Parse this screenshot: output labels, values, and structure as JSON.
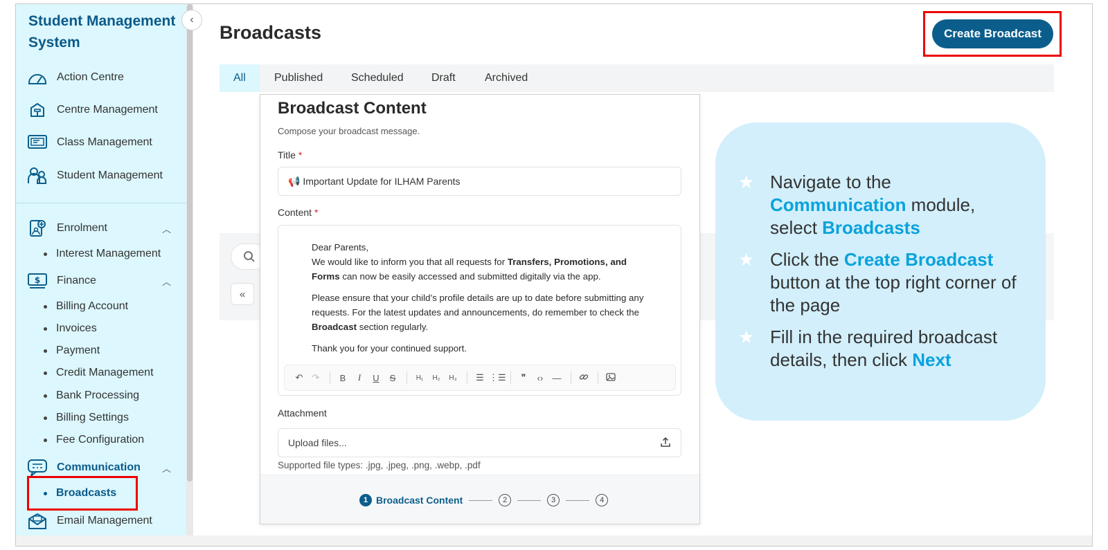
{
  "sidebar": {
    "app_title": "Student Management System",
    "items": {
      "action_centre": "Action Centre",
      "centre_management": "Centre Management",
      "class_management": "Class Management",
      "student_management": "Student Management",
      "enrolment": "Enrolment",
      "interest_management": "Interest Management",
      "finance": "Finance",
      "billing_account": "Billing Account",
      "invoices": "Invoices",
      "payment": "Payment",
      "credit_management": "Credit Management",
      "bank_processing": "Bank Processing",
      "billing_settings": "Billing Settings",
      "fee_configuration": "Fee Configuration",
      "communication": "Communication",
      "broadcasts": "Broadcasts",
      "email_management": "Email Management"
    }
  },
  "header": {
    "title": "Broadcasts",
    "create_button": "Create Broadcast"
  },
  "tabs": [
    "All",
    "Published",
    "Scheduled",
    "Draft",
    "Archived"
  ],
  "card": {
    "title": "Broadcast Content",
    "subtitle": "Compose your broadcast message.",
    "title_label": "Title",
    "title_value": "📢 Important Update for ILHAM Parents",
    "content_label": "Content",
    "content": {
      "greeting": "Dear Parents,",
      "p1_pre": "We would like to inform you that all requests for ",
      "p1_bold": "Transfers, Promotions, and Forms",
      "p1_post": " can now be easily accessed and submitted digitally via the app.",
      "p2_pre": "Please ensure that your child’s profile details are up to date before submitting any requests. For the latest updates and announcements, do remember to check the ",
      "p2_bold": "Broadcast",
      "p2_post": " section regularly.",
      "p3": "Thank you for your continued support."
    },
    "attachment_label": "Attachment",
    "upload_placeholder": "Upload files...",
    "supported_types": "Supported file types: .jpg, .jpeg, .png, .webp, .pdf",
    "stepper": {
      "step1_num": "1",
      "step1_label": "Broadcast Content",
      "step2": "2",
      "step3": "3",
      "step4": "4"
    }
  },
  "tooltip": {
    "item1_pre": "Navigate to the ",
    "item1_hl1": "Communication",
    "item1_mid": " module, select ",
    "item1_hl2": "Broadcasts",
    "item2_pre": "Click the ",
    "item2_hl": "Create Broadcast",
    "item2_post": " button at the top right corner of the page",
    "item3_pre": "Fill in the required broadcast details, then click ",
    "item3_hl": "Next"
  },
  "colors": {
    "brand": "#0b5e8c",
    "sidebar_bg": "#dcf7fd",
    "highlight_text": "#0aa2dc",
    "bubble_bg": "#d2effb",
    "annotation_red": "#ee0000"
  }
}
